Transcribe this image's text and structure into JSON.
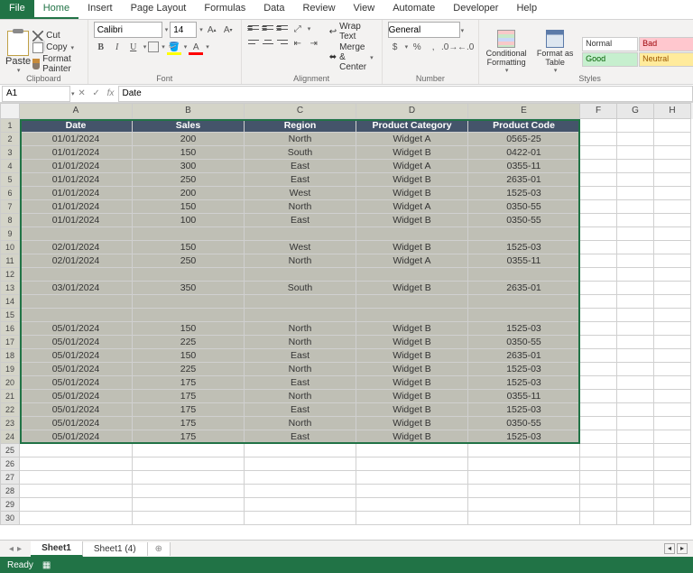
{
  "menu": {
    "file": "File",
    "tabs": [
      "Home",
      "Insert",
      "Page Layout",
      "Formulas",
      "Data",
      "Review",
      "View",
      "Automate",
      "Developer",
      "Help"
    ],
    "active": "Home"
  },
  "ribbon": {
    "clipboard": {
      "label": "Clipboard",
      "paste": "Paste",
      "cut": "Cut",
      "copy": "Copy",
      "painter": "Format Painter"
    },
    "font": {
      "label": "Font",
      "name": "Calibri",
      "size": "14"
    },
    "alignment": {
      "label": "Alignment",
      "wrap": "Wrap Text",
      "merge": "Merge & Center"
    },
    "number": {
      "label": "Number",
      "format": "General"
    },
    "styles": {
      "label": "Styles",
      "cond": "Conditional\nFormatting",
      "fmt": "Format as\nTable",
      "normal": "Normal",
      "bad": "Bad",
      "good": "Good",
      "neutral": "Neutral"
    }
  },
  "namebox": "A1",
  "formula": "Date",
  "columns": [
    "A",
    "B",
    "C",
    "D",
    "E",
    "F",
    "G",
    "H"
  ],
  "headers": [
    "Date",
    "Sales",
    "Region",
    "Product Category",
    "Product Code"
  ],
  "rows": [
    [
      "01/01/2024",
      "200",
      "North",
      "Widget A",
      "0565-25"
    ],
    [
      "01/01/2024",
      "150",
      "South",
      "Widget B",
      "0422-01"
    ],
    [
      "01/01/2024",
      "300",
      "East",
      "Widget A",
      "0355-11"
    ],
    [
      "01/01/2024",
      "250",
      "East",
      "Widget B",
      "2635-01"
    ],
    [
      "01/01/2024",
      "200",
      "West",
      "Widget B",
      "1525-03"
    ],
    [
      "01/01/2024",
      "150",
      "North",
      "Widget A",
      "0350-55"
    ],
    [
      "01/01/2024",
      "100",
      "East",
      "Widget B",
      "0350-55"
    ],
    [
      "",
      "",
      "",
      "",
      ""
    ],
    [
      "02/01/2024",
      "150",
      "West",
      "Widget B",
      "1525-03"
    ],
    [
      "02/01/2024",
      "250",
      "North",
      "Widget A",
      "0355-11"
    ],
    [
      "",
      "",
      "",
      "",
      ""
    ],
    [
      "03/01/2024",
      "350",
      "South",
      "Widget B",
      "2635-01"
    ],
    [
      "",
      "",
      "",
      "",
      ""
    ],
    [
      "",
      "",
      "",
      "",
      ""
    ],
    [
      "05/01/2024",
      "150",
      "North",
      "Widget B",
      "1525-03"
    ],
    [
      "05/01/2024",
      "225",
      "North",
      "Widget B",
      "0350-55"
    ],
    [
      "05/01/2024",
      "150",
      "East",
      "Widget B",
      "2635-01"
    ],
    [
      "05/01/2024",
      "225",
      "North",
      "Widget B",
      "1525-03"
    ],
    [
      "05/01/2024",
      "175",
      "East",
      "Widget B",
      "1525-03"
    ],
    [
      "05/01/2024",
      "175",
      "North",
      "Widget B",
      "0355-11"
    ],
    [
      "05/01/2024",
      "175",
      "East",
      "Widget B",
      "1525-03"
    ],
    [
      "05/01/2024",
      "175",
      "North",
      "Widget B",
      "0350-55"
    ],
    [
      "05/01/2024",
      "175",
      "East",
      "Widget B",
      "1525-03"
    ]
  ],
  "emptyRows": 6,
  "sheets": {
    "active": "Sheet1",
    "other": "Sheet1 (4)"
  },
  "status": "Ready"
}
